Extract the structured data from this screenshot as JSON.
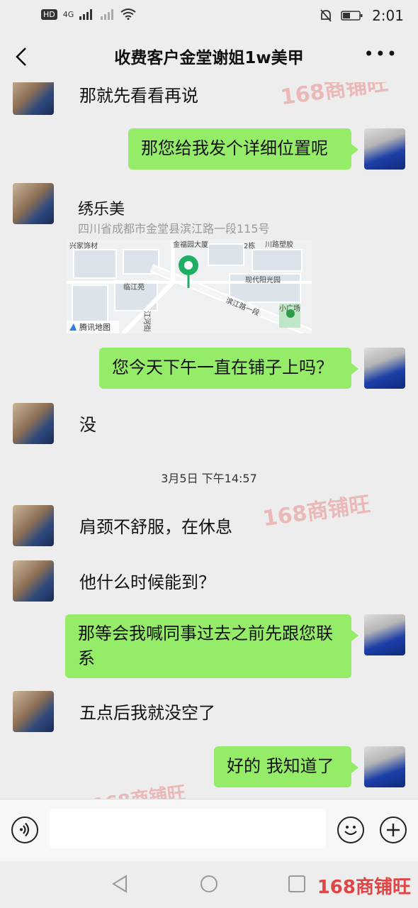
{
  "statusbar": {
    "time": "2:01",
    "network": "4G",
    "hd": "HD"
  },
  "header": {
    "title": "收费客户金堂谢姐1w美甲"
  },
  "messages": {
    "m1": "那就先看看再说",
    "m2": "那您给我发个详细位置呢",
    "location": {
      "name": "绣乐美",
      "address": "四川省成都市金堂县滨江路一段115号"
    },
    "m3": "您今天下午一直在铺子上吗？",
    "m4": "没",
    "timestamp": "3月5日 下午14:57",
    "m5": "肩颈不舒服，在休息",
    "m6": "他什么时候能到？",
    "m7": "那等会我喊同事过去之前先跟您联系",
    "m8": "五点后我就没空了",
    "m9": "好的 我知道了"
  },
  "map": {
    "labels": [
      "兴家饰材",
      "金福园大厦",
      "2栋",
      "川路塑胶",
      "临江苑",
      "现代阳光园",
      "滨江路一段",
      "小广场",
      "江河街"
    ],
    "provider": "腾讯地图"
  },
  "watermark": "168商铺旺",
  "brand": "168商铺旺",
  "colors": {
    "bubble_me": "#95ec69",
    "background": "#ededed"
  }
}
